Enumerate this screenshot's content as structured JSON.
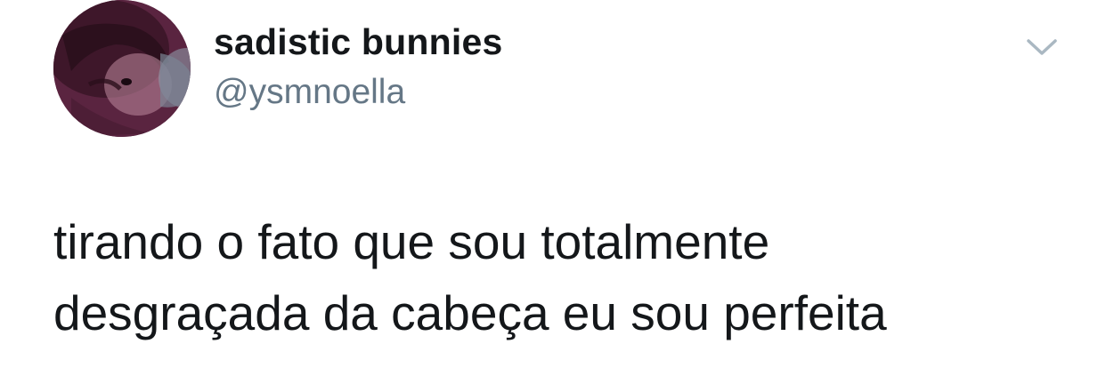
{
  "tweet": {
    "author": {
      "display_name": "sadistic bunnies",
      "handle": "@ysmnoella",
      "avatar_icon": "user-avatar-photo"
    },
    "menu_icon": "chevron-down-icon",
    "text_lines": [
      "tirando o fato que sou totalmente",
      "desgraçada da cabeça eu sou perfeita"
    ]
  },
  "colors": {
    "background": "#ffffff",
    "text_primary": "#14171a",
    "text_secondary": "#657786",
    "chevron": "#aab8c2"
  }
}
